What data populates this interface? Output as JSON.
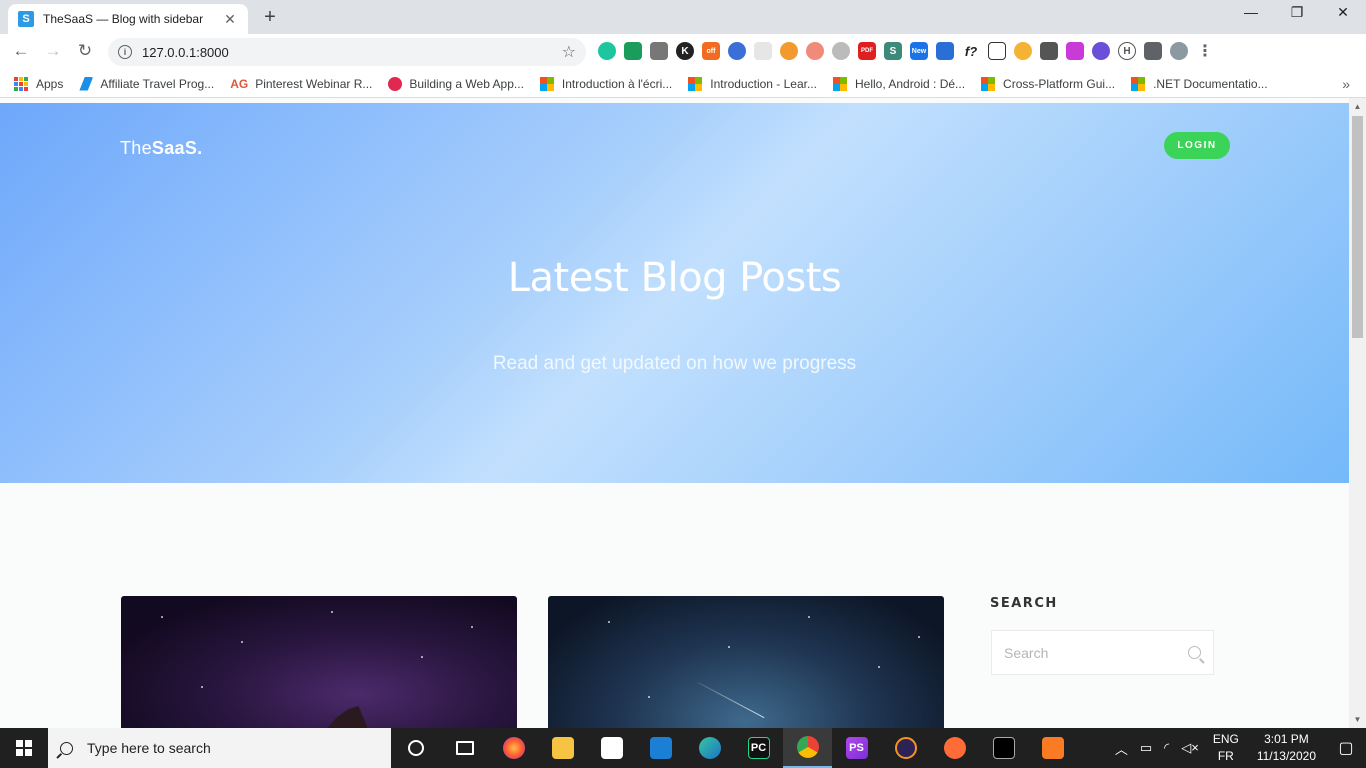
{
  "browser": {
    "tab_title": "TheSaaS — Blog with sidebar",
    "tab_favicon": "S",
    "url": "127.0.0.1:8000",
    "bookmarks": [
      {
        "label": "Apps",
        "icon": "apps-grid-icon"
      },
      {
        "label": "Affiliate Travel Prog...",
        "icon": "travel-icon"
      },
      {
        "label": "Pinterest Webinar R...",
        "icon": "ag-icon"
      },
      {
        "label": "Building a Web App...",
        "icon": "play-icon"
      },
      {
        "label": "Introduction à l'écri...",
        "icon": "microsoft-icon"
      },
      {
        "label": "Introduction - Lear...",
        "icon": "microsoft-icon"
      },
      {
        "label": "Hello, Android : Dé...",
        "icon": "microsoft-icon"
      },
      {
        "label": "Cross-Platform Gui...",
        "icon": "microsoft-icon"
      },
      {
        "label": ".NET Documentatio...",
        "icon": "microsoft-icon"
      }
    ],
    "bookmarks_more": "»",
    "extensions_text": {
      "f": "f?",
      "new": "New",
      "off": "off"
    }
  },
  "page": {
    "logo_light": "The",
    "logo_bold": "SaaS.",
    "login_label": "LOGIN",
    "hero_title": "Latest Blog Posts",
    "hero_subtitle": "Read and get updated on how we progress",
    "sidebar_search_title": "SEARCH",
    "search_placeholder": "Search"
  },
  "taskbar": {
    "search_placeholder": "Type here to search",
    "lang_top": "ENG",
    "lang_bottom": "FR",
    "time": "3:01 PM",
    "date": "11/13/2020",
    "pinned": [
      {
        "name": "task-view-icon",
        "label": ""
      },
      {
        "name": "firefox-icon",
        "label": ""
      },
      {
        "name": "file-explorer-icon",
        "label": ""
      },
      {
        "name": "store-icon",
        "label": ""
      },
      {
        "name": "mail-icon",
        "label": ""
      },
      {
        "name": "edge-icon",
        "label": ""
      },
      {
        "name": "pycharm-icon",
        "label": "PC"
      },
      {
        "name": "chrome-icon",
        "label": ""
      },
      {
        "name": "phpstorm-icon",
        "label": "PS"
      },
      {
        "name": "eclipse-icon",
        "label": ""
      },
      {
        "name": "postman-icon",
        "label": ""
      },
      {
        "name": "cmd-icon",
        "label": ""
      },
      {
        "name": "xampp-icon",
        "label": ""
      }
    ]
  },
  "colors": {
    "login_green": "#3cd458",
    "hero_blue": "#a9d0fc"
  }
}
